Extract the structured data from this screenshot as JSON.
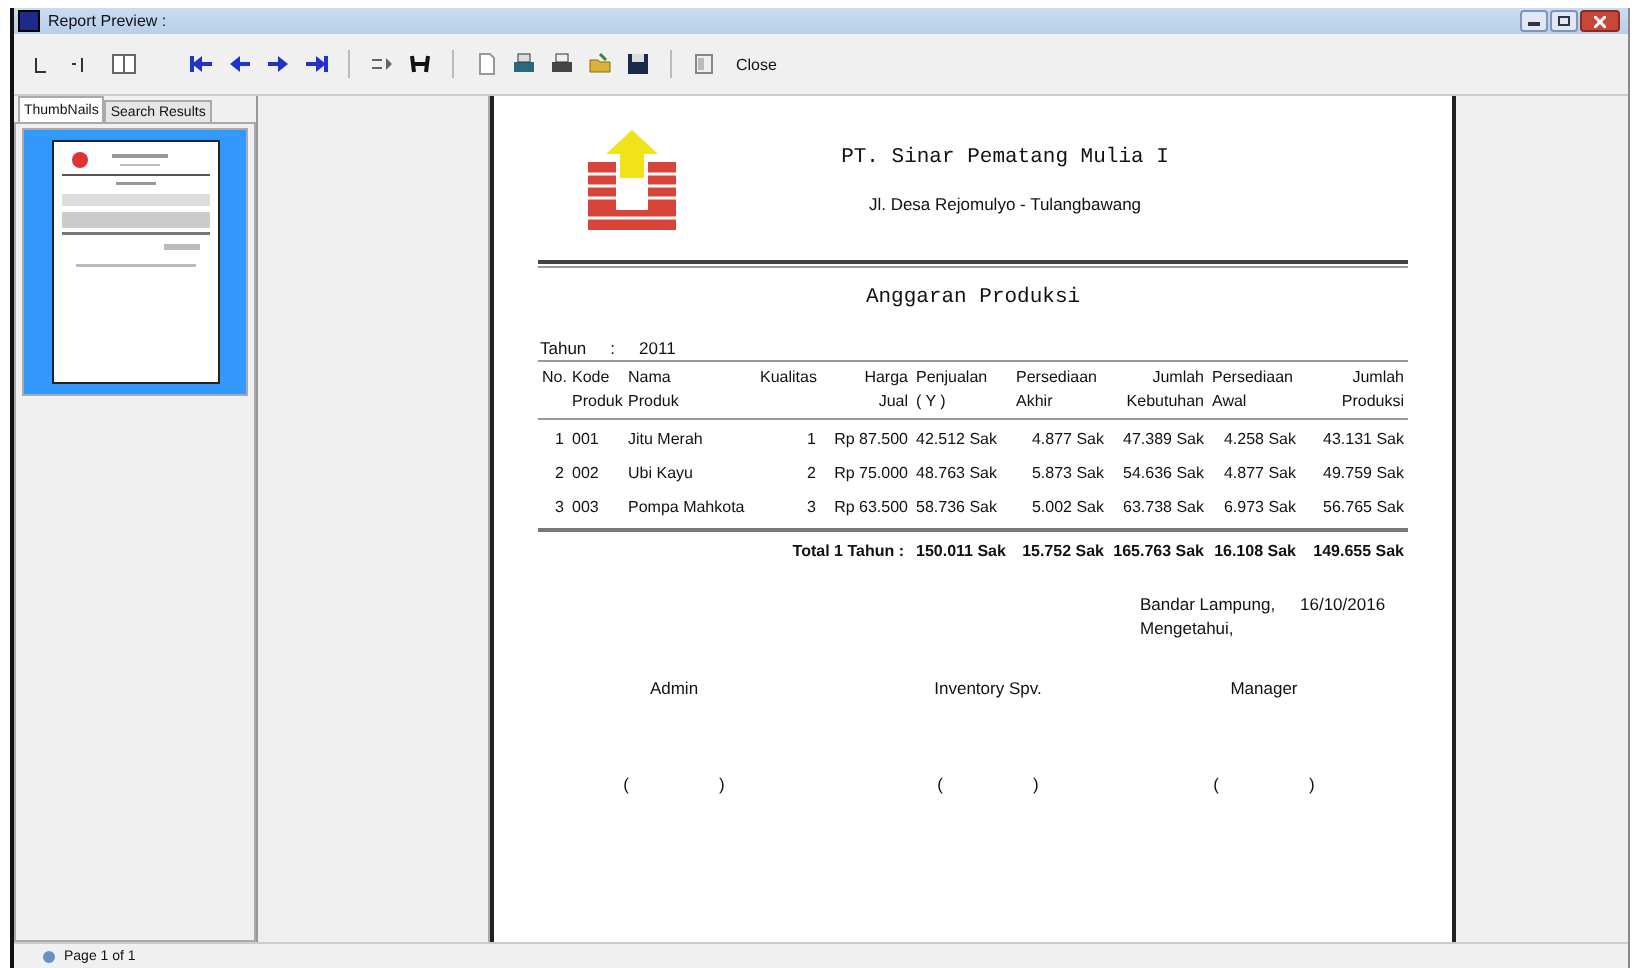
{
  "window": {
    "title": "Report Preview :"
  },
  "toolbar": {
    "close_label": "Close"
  },
  "tabs": [
    {
      "label": "ThumbNails",
      "selected": true
    },
    {
      "label": "Search Results",
      "selected": false
    }
  ],
  "thumbnails": [
    {
      "selected": true
    }
  ],
  "report": {
    "company": "PT. Sinar Pematang Mulia I",
    "address": "Jl. Desa Rejomulyo - Tulangbawang",
    "title": "Anggaran Produksi",
    "year_label": "Tahun",
    "year_sep": ":",
    "year": "2011",
    "columns": [
      "No.",
      "Kode\nProduk",
      "Nama\nProduk",
      "Kualitas",
      "Harga\nJual",
      "Penjualan\n( Y )",
      "Persediaan\nAkhir",
      "Jumlah\nKebutuhan",
      "Persediaan\nAwal",
      "Jumlah\nProduksi"
    ],
    "rows": [
      [
        "1",
        "001",
        "Jitu Merah",
        "1",
        "Rp 87.500",
        "42.512 Sak",
        "4.877 Sak",
        "47.389 Sak",
        "4.258 Sak",
        "43.131 Sak"
      ],
      [
        "2",
        "002",
        "Ubi Kayu",
        "2",
        "Rp 75.000",
        "48.763 Sak",
        "5.873 Sak",
        "54.636 Sak",
        "4.877 Sak",
        "49.759 Sak"
      ],
      [
        "3",
        "003",
        "Pompa Mahkota",
        "3",
        "Rp 63.500",
        "58.736 Sak",
        "5.002 Sak",
        "63.738 Sak",
        "6.973 Sak",
        "56.765 Sak"
      ]
    ],
    "total": {
      "label": "Total 1 Tahun :",
      "values": [
        "150.011 Sak",
        "15.752 Sak",
        "165.763 Sak",
        "16.108 Sak",
        "149.655 Sak"
      ]
    },
    "place": "Bandar Lampung,",
    "date": "16/10/2016",
    "acknowledged": "Mengetahui,",
    "signers": [
      {
        "role": "Admin",
        "open": "(",
        "close": ")"
      },
      {
        "role": "Inventory Spv.",
        "open": "(",
        "close": ")"
      },
      {
        "role": "Manager",
        "open": "(",
        "close": ")"
      }
    ]
  },
  "status_bar": {
    "page": "Page 1 of 1"
  }
}
